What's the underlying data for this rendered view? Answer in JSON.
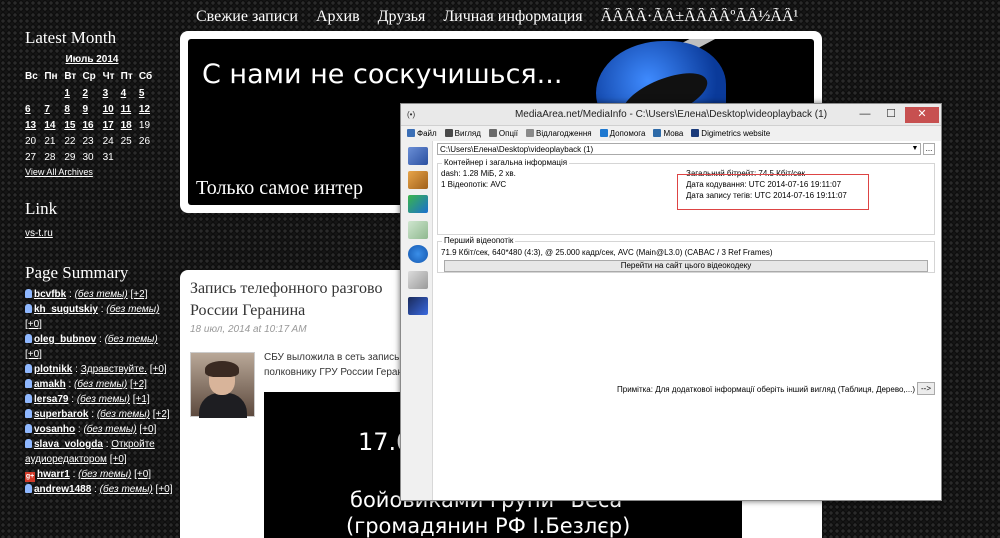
{
  "nav": {
    "items": [
      "Свежие записи",
      "Архив",
      "Друзья",
      "Личная информация",
      "ÃÂÂÂ·ÃÂ±ÃÂÂÂºÃÂ½ÃÂ¹"
    ]
  },
  "banner": {
    "title": "С нами не соскучишься...",
    "subtitle": "Только самое интер"
  },
  "sidebar": {
    "latest_month_title": "Latest Month",
    "calendar": {
      "caption": "Июль 2014",
      "weekdays": [
        "Вс",
        "Пн",
        "Вт",
        "Ср",
        "Чт",
        "Пт",
        "Сб"
      ],
      "weeks": [
        [
          "",
          "",
          "1",
          "2",
          "3",
          "4",
          "5"
        ],
        [
          "6",
          "7",
          "8",
          "9",
          "10",
          "11",
          "12"
        ],
        [
          "13",
          "14",
          "15",
          "16",
          "17",
          "18",
          "19"
        ],
        [
          "20",
          "21",
          "22",
          "23",
          "24",
          "25",
          "26"
        ],
        [
          "27",
          "28",
          "29",
          "30",
          "31",
          "",
          ""
        ]
      ],
      "linked_days": [
        "1",
        "2",
        "3",
        "4",
        "5",
        "6",
        "7",
        "8",
        "9",
        "10",
        "11",
        "12",
        "13",
        "14",
        "15",
        "16",
        "17",
        "18"
      ]
    },
    "view_all": "View All Archives",
    "link_title": "Link",
    "link_url": "vs-t.ru",
    "summary_title": "Page Summary",
    "summary": [
      {
        "user": "bcvfbk",
        "topic": "(без темы)",
        "count": "[+2]",
        "icon": "pin"
      },
      {
        "user": "kh_sugutskiy",
        "topic": "(без темы)",
        "count": "[+0]",
        "icon": "pin"
      },
      {
        "user": "oleg_bubnov",
        "topic": "(без темы)",
        "count": "[+0]",
        "icon": "pin"
      },
      {
        "user": "plotnikk",
        "topic": "Здравствуйте.",
        "count": "[+0]",
        "icon": "pin",
        "plain_topic": true
      },
      {
        "user": "amakh",
        "topic": "(без темы)",
        "count": "[+2]",
        "icon": "pin"
      },
      {
        "user": "lersa79",
        "topic": "(без темы)",
        "count": "[+1]",
        "icon": "pin"
      },
      {
        "user": "superbarok",
        "topic": "(без темы)",
        "count": "[+2]",
        "icon": "pin"
      },
      {
        "user": "vosanho",
        "topic": "(без темы)",
        "count": "[+0]",
        "icon": "pin"
      },
      {
        "user": "slava_vologda",
        "topic": "Откройте аудиоредактором",
        "count": "[+0]",
        "icon": "pin",
        "plain_topic": true
      },
      {
        "user": "hwarr1",
        "topic": "(без темы)",
        "count": "[+0]",
        "icon": "gplus"
      },
      {
        "user": "andrew1488",
        "topic": "(без темы)",
        "count": "[+0]",
        "icon": "pin"
      }
    ]
  },
  "post": {
    "title_line1": "Запись телефонного разгово",
    "title_line2": "России Геранина",
    "date": "18 июл, 2014 at 10:17 AM",
    "text_line1": "СБУ выложила в сеть запись те",
    "text_line2": "полковнику ГРУ России Герани",
    "video_line1": "17.0",
    "video_line2": "бойовиками групи \"Беса\"",
    "video_line3": "(громадянин РФ І.Безлєр)"
  },
  "mediainfo": {
    "window_title": "MediaArea.net/MediaInfo - C:\\Users\\Елена\\Desktop\\videoplayback (1)",
    "app_icon_text": "(•)",
    "minimize": "—",
    "maximize": "☐",
    "close": "✕",
    "menu": [
      {
        "label": "Файл",
        "color": "#3b6fb6"
      },
      {
        "label": "Вигляд",
        "color": "#4a4a4a"
      },
      {
        "label": "Опції",
        "color": "#6a6a6a"
      },
      {
        "label": "Відлагодження",
        "color": "#8a8a8a"
      },
      {
        "label": "Допомога",
        "color": "#1e78d0"
      },
      {
        "label": "Мова",
        "color": "#2d6aa8"
      },
      {
        "label": "Digimetrics website",
        "color": "#1a3a7a"
      }
    ],
    "path": "C:\\Users\\Елена\\Desktop\\videoplayback (1)",
    "path_button": "...",
    "dropdown_arrow": "▼",
    "general_label": "Контейнер і загальна інформація",
    "general_line1": "dash: 1.28 МіБ, 2 хв.",
    "general_line2": "1 Відеопотік: AVC",
    "bitrate": "Загальний бітрейт: 74.5 Кбіт/сек",
    "encoded_date": "Дата кодування: UTC 2014-07-16 19:11:07",
    "tagged_date": "Дата запису тегів: UTC 2014-07-16 19:11:07",
    "video_label": "Перший відеопотік",
    "video_line": "71.9 Кбіт/сек, 640*480 (4:3), @ 25.000 кадр/сек, AVC (Main@L3.0) (CABAC / 3 Ref Frames)",
    "codec_button": "Перейти на сайт цього відеокодеку",
    "note": "Примітка: Для додаткової інформації оберіть інший вигляд (Таблиця, Дерево,...)",
    "note_button": "-->"
  }
}
